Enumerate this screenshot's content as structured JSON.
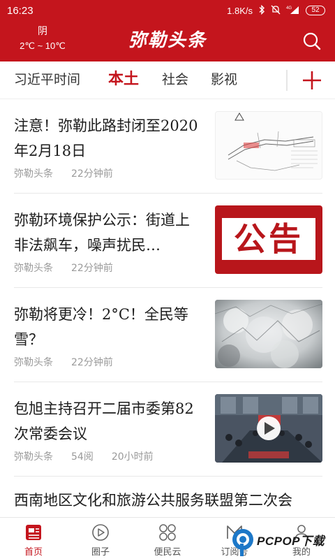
{
  "status_bar": {
    "time": "16:23",
    "network_speed": "1.8K/s",
    "signal_label": "4G",
    "battery": "52"
  },
  "header": {
    "weather_condition": "阴",
    "weather_temp": "2℃ ~ 10℃",
    "brand": "弥勒头条"
  },
  "tabs": [
    {
      "label": "习近平时间"
    },
    {
      "label": "本土"
    },
    {
      "label": "社会"
    },
    {
      "label": "影视"
    }
  ],
  "feed": [
    {
      "title": "注意！弥勒此路封闭至2020年2月18日",
      "source": "弥勒头条",
      "views": "",
      "time": "22分钟前",
      "thumb": "road-map"
    },
    {
      "title": "弥勒环境保护公示：街道上非法飙车，噪声扰民…",
      "source": "弥勒头条",
      "views": "",
      "time": "22分钟前",
      "thumb": "notice",
      "thumb_text": "公告"
    },
    {
      "title": "弥勒将更冷！2°C！全民等雪？",
      "source": "弥勒头条",
      "views": "",
      "time": "22分钟前",
      "thumb": "frost"
    },
    {
      "title": "包旭主持召开二届市委第82次常委会议",
      "source": "弥勒头条",
      "views": "54阅",
      "time": "20小时前",
      "thumb": "video-meeting"
    },
    {
      "title": "西南地区文化和旅游公共服务联盟第二次会",
      "source": "",
      "views": "",
      "time": "",
      "thumb": ""
    }
  ],
  "bottom_nav": [
    {
      "label": "首页",
      "icon": "home-news-icon",
      "active": true
    },
    {
      "label": "圈子",
      "icon": "circle-play-icon",
      "active": false
    },
    {
      "label": "便民云",
      "icon": "grid-icon",
      "active": false
    },
    {
      "label": "订阅号",
      "icon": "subscribe-icon",
      "active": false
    },
    {
      "label": "我的",
      "icon": "person-icon",
      "active": false
    }
  ],
  "watermark": {
    "text": "PCPOP下载"
  },
  "colors": {
    "brand_red": "#c4151d",
    "meta_gray": "#9a9a9a"
  }
}
